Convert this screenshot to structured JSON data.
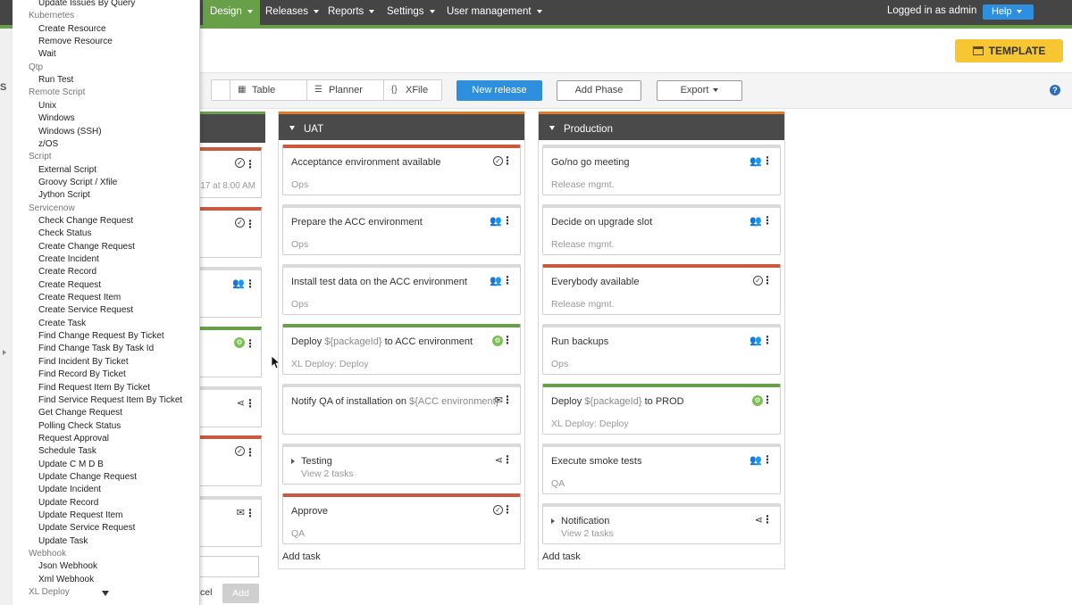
{
  "nav": {
    "items": [
      {
        "label": "Design",
        "active": true
      },
      {
        "label": "Releases"
      },
      {
        "label": "Reports"
      },
      {
        "label": "Settings"
      },
      {
        "label": "User management"
      }
    ],
    "logged_in": "Logged in as admin",
    "help": "Help"
  },
  "header": {
    "template_label": "TEMPLATE"
  },
  "toolbar": {
    "partial_letter": "S",
    "views": [
      {
        "label": "Table",
        "icon": "table-icon"
      },
      {
        "label": "Planner",
        "icon": "planner-icon"
      },
      {
        "label": "XFile",
        "icon": "xfile-icon"
      }
    ],
    "new_release": "New release",
    "add_phase": "Add Phase",
    "export": "Export"
  },
  "left_phase": {
    "time_text": "17 at 8:00 AM",
    "cancel_text": "cel",
    "add_text": "Add"
  },
  "phases": [
    {
      "name": "UAT",
      "add_task": "Add task",
      "tasks": [
        {
          "title": "Acceptance environment available",
          "sub": "Ops",
          "color": "red",
          "icon": "check-icon"
        },
        {
          "title": "Prepare the ACC environment",
          "sub": "Ops",
          "color": "gray",
          "icon": "users-icon"
        },
        {
          "title": "Install test data on the ACC environment",
          "sub": "Ops",
          "color": "gray",
          "icon": "users-icon"
        },
        {
          "title_pre": "Deploy ",
          "title_var": "${packageId}",
          "title_post": " to ACC environment",
          "sub": "XL Deploy: Deploy",
          "color": "green",
          "icon": "xl-deploy-icon"
        },
        {
          "title_pre": "Notify QA of installation on ",
          "title_var": "${ACC environment}",
          "title_post": "",
          "sub": "",
          "color": "gray",
          "icon": "mail-icon"
        },
        {
          "title": "Testing",
          "sub": "View 2 tasks",
          "color": "gray",
          "icon": "share-icon",
          "group": true
        },
        {
          "title": "Approve",
          "sub": "QA",
          "color": "red",
          "icon": "check-icon"
        }
      ]
    },
    {
      "name": "Production",
      "add_task": "Add task",
      "tasks": [
        {
          "title": "Go/no go meeting",
          "sub": "Release mgmt.",
          "color": "gray",
          "icon": "users-icon"
        },
        {
          "title": "Decide on upgrade slot",
          "sub": "Release mgmt.",
          "color": "gray",
          "icon": "users-icon"
        },
        {
          "title": "Everybody available",
          "sub": "Release mgmt.",
          "color": "red",
          "icon": "check-icon"
        },
        {
          "title": "Run backups",
          "sub": "Ops",
          "color": "gray",
          "icon": "users-icon"
        },
        {
          "title_pre": "Deploy ",
          "title_var": "${packageId}",
          "title_post": " to PROD",
          "sub": "XL Deploy: Deploy",
          "color": "green",
          "icon": "xl-deploy-icon"
        },
        {
          "title": "Execute smoke tests",
          "sub": "QA",
          "color": "gray",
          "icon": "users-icon"
        },
        {
          "title": "Notification",
          "sub": "View 2 tasks",
          "color": "gray",
          "icon": "share-icon",
          "group": true
        }
      ]
    }
  ],
  "dropdown": [
    {
      "type": "item",
      "label": "Update Issues By Query"
    },
    {
      "type": "cat",
      "label": "Kubernetes"
    },
    {
      "type": "item",
      "label": "Create Resource"
    },
    {
      "type": "item",
      "label": "Remove Resource"
    },
    {
      "type": "item",
      "label": "Wait"
    },
    {
      "type": "cat",
      "label": "Qtp"
    },
    {
      "type": "item",
      "label": "Run Test"
    },
    {
      "type": "cat",
      "label": "Remote Script"
    },
    {
      "type": "item",
      "label": "Unix"
    },
    {
      "type": "item",
      "label": "Windows"
    },
    {
      "type": "item",
      "label": "Windows (SSH)"
    },
    {
      "type": "item",
      "label": "z/OS"
    },
    {
      "type": "cat",
      "label": "Script"
    },
    {
      "type": "item",
      "label": "External Script"
    },
    {
      "type": "item",
      "label": "Groovy Script / Xfile"
    },
    {
      "type": "item",
      "label": "Jython Script"
    },
    {
      "type": "cat",
      "label": "Servicenow"
    },
    {
      "type": "item",
      "label": "Check Change Request"
    },
    {
      "type": "item",
      "label": "Check Status"
    },
    {
      "type": "item",
      "label": "Create Change Request"
    },
    {
      "type": "item",
      "label": "Create Incident"
    },
    {
      "type": "item",
      "label": "Create Record"
    },
    {
      "type": "item",
      "label": "Create Request"
    },
    {
      "type": "item",
      "label": "Create Request Item"
    },
    {
      "type": "item",
      "label": "Create Service Request"
    },
    {
      "type": "item",
      "label": "Create Task"
    },
    {
      "type": "item",
      "label": "Find Change Request By Ticket"
    },
    {
      "type": "item",
      "label": "Find Change Task By Task Id"
    },
    {
      "type": "item",
      "label": "Find Incident By Ticket"
    },
    {
      "type": "item",
      "label": "Find Record By Ticket"
    },
    {
      "type": "item",
      "label": "Find Request Item By Ticket"
    },
    {
      "type": "item",
      "label": "Find Service Request Item By Ticket"
    },
    {
      "type": "item",
      "label": "Get Change Request"
    },
    {
      "type": "item",
      "label": "Polling Check Status"
    },
    {
      "type": "item",
      "label": "Request Approval"
    },
    {
      "type": "item",
      "label": "Schedule Task"
    },
    {
      "type": "item",
      "label": "Update C M D B"
    },
    {
      "type": "item",
      "label": "Update Change Request"
    },
    {
      "type": "item",
      "label": "Update Incident"
    },
    {
      "type": "item",
      "label": "Update Record"
    },
    {
      "type": "item",
      "label": "Update Request Item"
    },
    {
      "type": "item",
      "label": "Update Service Request"
    },
    {
      "type": "item",
      "label": "Update Task"
    },
    {
      "type": "cat",
      "label": "Webhook"
    },
    {
      "type": "item",
      "label": "Json Webhook"
    },
    {
      "type": "item",
      "label": "Xml Webhook"
    },
    {
      "type": "cat",
      "label": "XL Deploy"
    }
  ]
}
